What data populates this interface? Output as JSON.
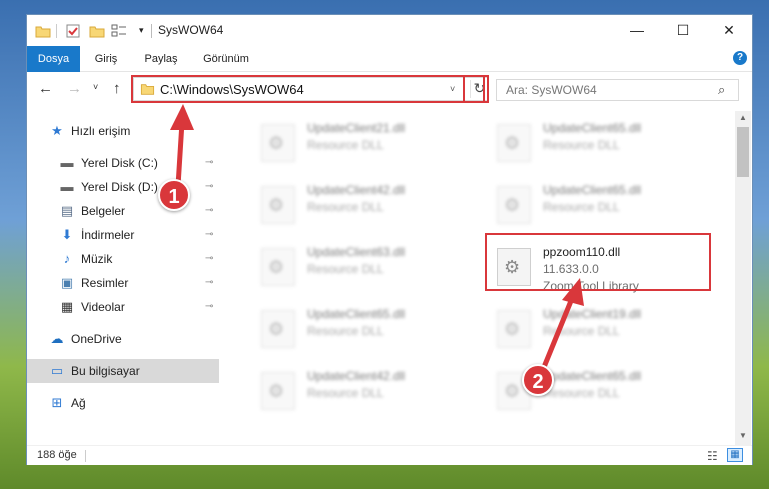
{
  "window": {
    "title": "SysWOW64",
    "buttons": {
      "minimize": "—",
      "maximize": "☐",
      "close": "✕"
    }
  },
  "ribbon": {
    "tabs": [
      "Dosya",
      "Giriş",
      "Paylaş",
      "Görünüm"
    ],
    "help": "?"
  },
  "navigation": {
    "back": "←",
    "forward": "→",
    "recent": "˅",
    "up": "↑",
    "address": "C:\\Windows\\SysWOW64",
    "address_dropdown": "˅",
    "refresh": "↻",
    "search_placeholder": "Ara: SysWOW64",
    "search_icon": "⌕"
  },
  "sidebar": {
    "items": [
      {
        "label": "Hızlı erişim",
        "icon": "star-icon",
        "glyph": "★",
        "color": "#2f7ad3",
        "pinned": false
      },
      {
        "label": "Yerel Disk (C:)",
        "icon": "drive-icon",
        "glyph": "▬",
        "color": "#666666",
        "pinned": true
      },
      {
        "label": "Yerel Disk (D:)",
        "icon": "drive-icon",
        "glyph": "▬",
        "color": "#666666",
        "pinned": true
      },
      {
        "label": "Belgeler",
        "icon": "document-icon",
        "glyph": "▤",
        "color": "#5b6f8a",
        "pinned": true
      },
      {
        "label": "İndirmeler",
        "icon": "download-icon",
        "glyph": "⬇",
        "color": "#2f7ad3",
        "pinned": true
      },
      {
        "label": "Müzik",
        "icon": "music-icon",
        "glyph": "♪",
        "color": "#2f7ad3",
        "pinned": true
      },
      {
        "label": "Resimler",
        "icon": "picture-icon",
        "glyph": "▣",
        "color": "#4a7fb0",
        "pinned": true
      },
      {
        "label": "Videolar",
        "icon": "video-icon",
        "glyph": "▦",
        "color": "#333333",
        "pinned": true
      },
      {
        "label": "OneDrive",
        "icon": "cloud-icon",
        "glyph": "☁",
        "color": "#1f6fc0",
        "pinned": false
      },
      {
        "label": "Bu bilgisayar",
        "icon": "computer-icon",
        "glyph": "▭",
        "color": "#2f7ad3",
        "pinned": false,
        "selected": true
      },
      {
        "label": "Ağ",
        "icon": "network-icon",
        "glyph": "⊞",
        "color": "#2f7ad3",
        "pinned": false
      }
    ],
    "pin_glyph": "📌"
  },
  "files": [
    {
      "name": "UpdateClient21.dll",
      "desc": "Resource DLL",
      "blurred": true
    },
    {
      "name": "UpdateClient65.dll",
      "desc": "Resource DLL",
      "blurred": true
    },
    {
      "name": "UpdateClient42.dll",
      "desc": "Resource DLL",
      "blurred": true
    },
    {
      "name": "UpdateClient65.dll",
      "desc": "Resource DLL",
      "blurred": true
    },
    {
      "name": "UpdateClient63.dll",
      "desc": "Resource DLL",
      "blurred": true
    },
    {
      "name": "ppzoom110.dll",
      "version": "11.633.0.0",
      "desc": "Zoom Tool Library",
      "blurred": false
    },
    {
      "name": "UpdateClient65.dll",
      "desc": "Resource DLL",
      "blurred": true
    },
    {
      "name": "UpdateClient19.dll",
      "desc": "Resource DLL",
      "blurred": true
    },
    {
      "name": "UpdateClient42.dll",
      "desc": "Resource DLL",
      "blurred": true
    },
    {
      "name": "UpdateClient65.dll",
      "desc": "Resource DLL",
      "blurred": true
    }
  ],
  "status": {
    "count": "188 öğe"
  },
  "annotations": {
    "marker1": "1",
    "marker2": "2",
    "color": "#d9373b"
  }
}
